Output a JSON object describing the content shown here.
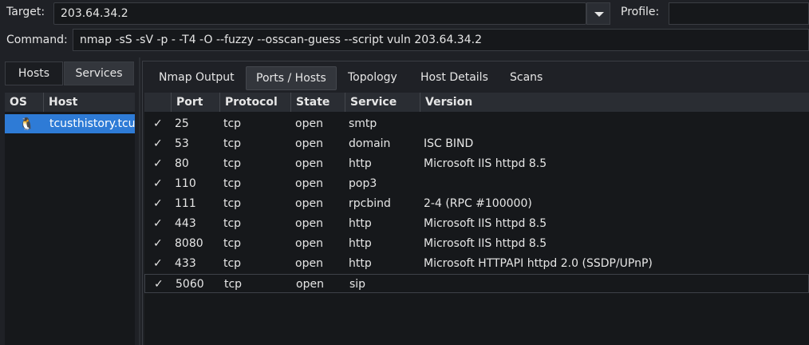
{
  "toolbar": {
    "target_label": "Target:",
    "target_value": "203.64.34.2",
    "profile_label": "Profile:",
    "profile_value": "",
    "command_label": "Command:",
    "command_value": "nmap -sS -sV -p - -T4 -O --fuzzy --osscan-guess --script vuln 203.64.34.2"
  },
  "left_tabs": [
    {
      "label": "Hosts",
      "active": false
    },
    {
      "label": "Services",
      "active": true
    }
  ],
  "hosts_table": {
    "columns": [
      "OS",
      "Host"
    ],
    "rows": [
      {
        "os_icon": "linux-penguin-icon",
        "os_glyph": "🐧",
        "host": "tcusthistory.tcus"
      }
    ]
  },
  "right_tabs": [
    {
      "label": "Nmap Output",
      "active": false
    },
    {
      "label": "Ports / Hosts",
      "active": true
    },
    {
      "label": "Topology",
      "active": false
    },
    {
      "label": "Host Details",
      "active": false
    },
    {
      "label": "Scans",
      "active": false
    }
  ],
  "ports_table": {
    "columns": [
      "",
      "Port",
      "Protocol",
      "State",
      "Service",
      "Version"
    ],
    "rows": [
      {
        "check": "✓",
        "port": "25",
        "protocol": "tcp",
        "state": "open",
        "service": "smtp",
        "version": ""
      },
      {
        "check": "✓",
        "port": "53",
        "protocol": "tcp",
        "state": "open",
        "service": "domain",
        "version": "ISC BIND"
      },
      {
        "check": "✓",
        "port": "80",
        "protocol": "tcp",
        "state": "open",
        "service": "http",
        "version": "Microsoft IIS httpd 8.5"
      },
      {
        "check": "✓",
        "port": "110",
        "protocol": "tcp",
        "state": "open",
        "service": "pop3",
        "version": ""
      },
      {
        "check": "✓",
        "port": "111",
        "protocol": "tcp",
        "state": "open",
        "service": "rpcbind",
        "version": "2-4 (RPC #100000)"
      },
      {
        "check": "✓",
        "port": "443",
        "protocol": "tcp",
        "state": "open",
        "service": "http",
        "version": "Microsoft IIS httpd 8.5"
      },
      {
        "check": "✓",
        "port": "8080",
        "protocol": "tcp",
        "state": "open",
        "service": "http",
        "version": "Microsoft IIS httpd 8.5"
      },
      {
        "check": "✓",
        "port": "433",
        "protocol": "tcp",
        "state": "open",
        "service": "http",
        "version": "Microsoft HTTPAPI httpd 2.0 (SSDP/UPnP)"
      },
      {
        "check": "✓",
        "port": "5060",
        "protocol": "tcp",
        "state": "open",
        "service": "sip",
        "version": ""
      }
    ]
  },
  "colors": {
    "background": "#1f2126",
    "selection": "#2e7bd6",
    "header": "#2a2d33"
  }
}
